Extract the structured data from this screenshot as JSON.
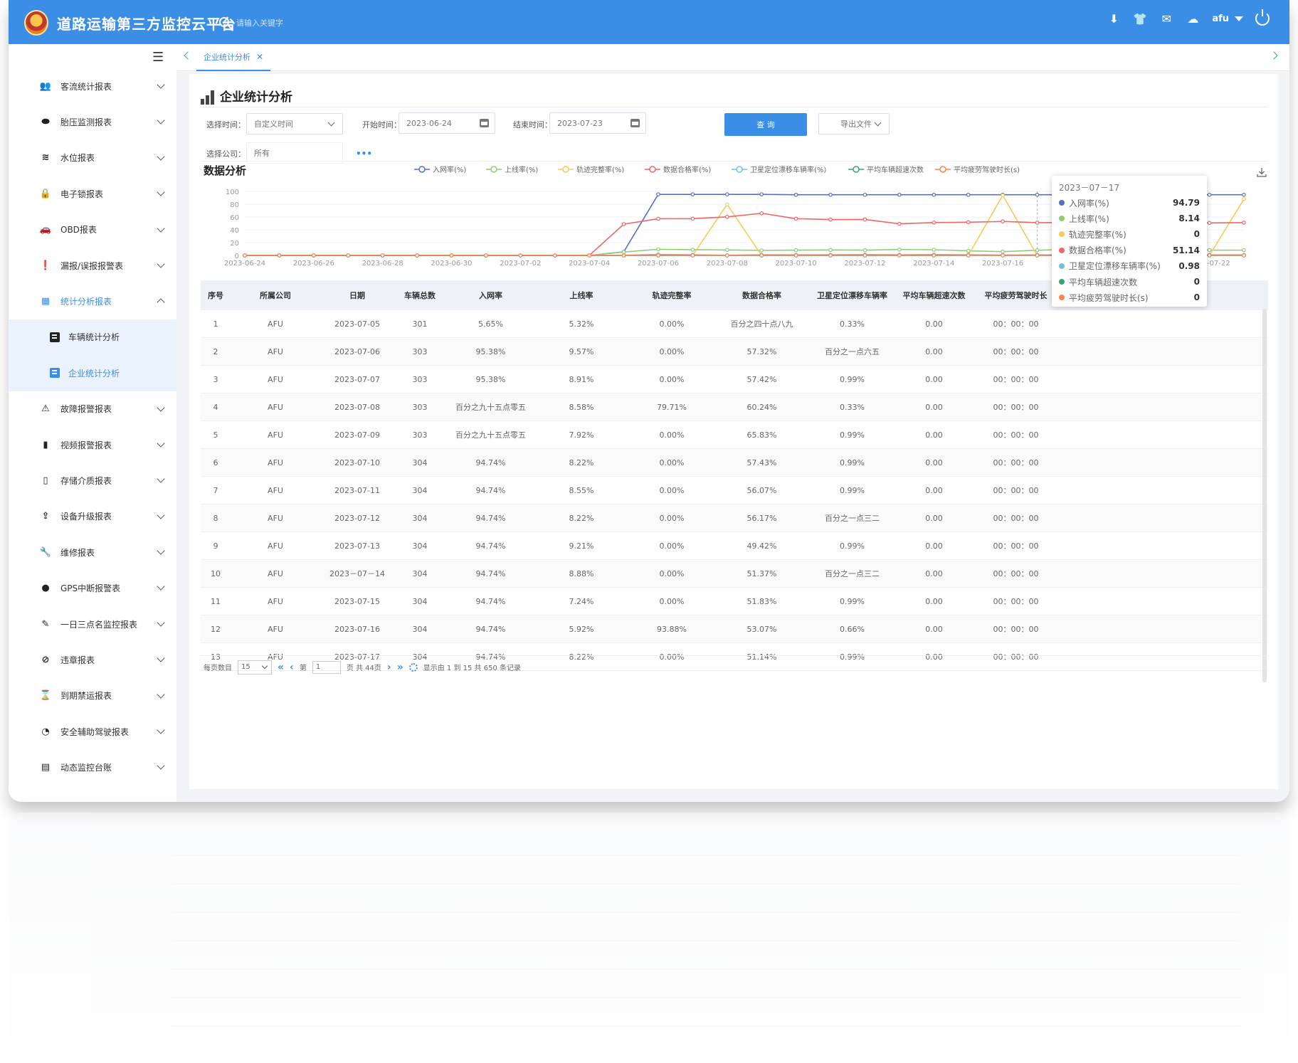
{
  "app": {
    "title": "道路运输第三方监控云平台",
    "search_placeholder": "请输入关键字",
    "user": "afu"
  },
  "sidebar": {
    "items": [
      {
        "label": "客流统计报表",
        "icon": "users-icon"
      },
      {
        "label": "胎压监测报表",
        "icon": "tire-icon"
      },
      {
        "label": "水位报表",
        "icon": "water-icon"
      },
      {
        "label": "电子锁报表",
        "icon": "lock-icon"
      },
      {
        "label": "OBD报表",
        "icon": "car-icon"
      },
      {
        "label": "漏报/误报报警表",
        "icon": "alert-icon"
      },
      {
        "label": "统计分析报表",
        "icon": "table-icon",
        "expanded": true
      },
      {
        "label": "故障报警报表",
        "icon": "fault-icon"
      },
      {
        "label": "视频报警报表",
        "icon": "video-icon"
      },
      {
        "label": "存储介质报表",
        "icon": "storage-icon"
      },
      {
        "label": "设备升级报表",
        "icon": "upload-icon"
      },
      {
        "label": "维修报表",
        "icon": "wrench-icon"
      },
      {
        "label": "GPS中断报警表",
        "icon": "location-icon"
      },
      {
        "label": "一日三点名监控报表",
        "icon": "edit-icon"
      },
      {
        "label": "违章报表",
        "icon": "ban-icon"
      },
      {
        "label": "到期禁运报表",
        "icon": "hourglass-icon"
      },
      {
        "label": "安全辅助驾驶报表",
        "icon": "gauge-icon"
      },
      {
        "label": "动态监控台账",
        "icon": "ledger-icon"
      }
    ],
    "sub_items": [
      {
        "label": "车辆统计分析"
      },
      {
        "label": "企业统计分析",
        "active": true
      }
    ]
  },
  "tabs": [
    {
      "label": "企业统计分析"
    }
  ],
  "page": {
    "title": "企业统计分析"
  },
  "filters": {
    "time_label": "选择时间：",
    "time_value": "自定义时间",
    "start_label": "开始时间：",
    "start_value": "2023-06-24",
    "end_label": "结束时间：",
    "end_value": "2023-07-23",
    "query_label": "查 询",
    "export_label": "导出文件",
    "company_label": "选择公司：",
    "company_value": "所有",
    "more": "•••"
  },
  "chart_data": {
    "type": "line",
    "title": "数据分析",
    "x": [
      "2023-06-24",
      "2023-06-25",
      "2023-06-26",
      "2023-06-27",
      "2023-06-28",
      "2023-06-29",
      "2023-06-30",
      "2023-07-01",
      "2023-07-02",
      "2023-07-03",
      "2023-07-04",
      "2023-07-05",
      "2023-07-06",
      "2023-07-07",
      "2023-07-08",
      "2023-07-09",
      "2023-07-10",
      "2023-07-11",
      "2023-07-12",
      "2023-07-13",
      "2023-07-14",
      "2023-07-15",
      "2023-07-16",
      "2023-07-17",
      "2023-07-18",
      "2023-07-19",
      "2023-07-20",
      "2023-07-21",
      "2023-07-22",
      "2023-07-23"
    ],
    "x_tick_labels": [
      "2023-06-24",
      "2023-06-26",
      "2023-06-28",
      "2023-06-30",
      "2023-07-02",
      "2023-07-04",
      "2023-07-06",
      "2023-07-08",
      "2023-07-10",
      "2023-07-12",
      "2023-07-14",
      "2023-07-16",
      "2023-07-18",
      "2023-07-20",
      "2023-07-22"
    ],
    "ylim": [
      0,
      100
    ],
    "y_ticks": [
      0,
      20,
      40,
      60,
      80,
      100
    ],
    "legend_position": "top",
    "series": [
      {
        "name": "入网率(%)",
        "color": "#5470c6",
        "values": [
          0,
          0,
          0,
          0,
          0,
          0,
          0,
          0,
          0,
          0,
          0,
          5.65,
          95.38,
          95.38,
          95.38,
          95.38,
          94.74,
          94.74,
          94.74,
          94.74,
          94.74,
          94.74,
          94.74,
          94.79,
          94.79,
          94.79,
          94.79,
          94.79,
          94.79,
          94.79
        ]
      },
      {
        "name": "上线率(%)",
        "color": "#91cc75",
        "values": [
          0,
          0,
          0,
          0,
          0,
          0,
          0,
          0,
          0,
          0,
          0,
          5.32,
          9.57,
          8.91,
          8.58,
          7.92,
          8.22,
          8.55,
          8.22,
          9.21,
          8.88,
          7.24,
          5.92,
          8.14,
          9.5,
          8.2,
          8.6,
          8.1,
          8.3,
          8.2
        ]
      },
      {
        "name": "轨迹完整率(%)",
        "color": "#fac858",
        "values": [
          0,
          0,
          0,
          0,
          0,
          0,
          0,
          0,
          0,
          0,
          0,
          0,
          0,
          0,
          79.71,
          0,
          0,
          0,
          0,
          0,
          0,
          0,
          93.88,
          0,
          0,
          0,
          0,
          0,
          0,
          88
        ]
      },
      {
        "name": "数据合格率(%)",
        "color": "#ee6666",
        "values": [
          0,
          0,
          0,
          0,
          0,
          0,
          0,
          0,
          0,
          0,
          0,
          48.89,
          57.32,
          57.42,
          60.24,
          65.83,
          57.43,
          56.07,
          56.17,
          49.42,
          51.37,
          51.83,
          53.07,
          51.14,
          51.5,
          54.5,
          49.5,
          51.5,
          50.8,
          51.2
        ]
      },
      {
        "name": "卫星定位漂移车辆率(%)",
        "color": "#73c0de",
        "values": [
          0,
          0,
          0,
          0,
          0,
          0,
          0,
          0,
          0,
          0,
          0,
          0.33,
          1.65,
          0.99,
          0.33,
          0.99,
          0.99,
          0.99,
          1.32,
          0.99,
          1.32,
          0.99,
          0.66,
          0.98,
          0.9,
          0.9,
          0.9,
          0.9,
          0.9,
          0.9
        ]
      },
      {
        "name": "平均车辆超速次数",
        "color": "#3ba272",
        "values": [
          0,
          0,
          0,
          0,
          0,
          0,
          0,
          0,
          0,
          0,
          0,
          0,
          0,
          0,
          0,
          0,
          0,
          0,
          0,
          0,
          0,
          0,
          0,
          0,
          0,
          0,
          0,
          0,
          0,
          0
        ]
      },
      {
        "name": "平均疲劳驾驶时长(s)",
        "color": "#fc8452",
        "values": [
          0,
          0,
          0,
          0,
          0,
          0,
          0,
          0,
          0,
          0,
          0,
          0,
          0,
          0,
          0,
          0,
          0,
          0,
          0,
          0,
          0,
          0,
          0,
          0,
          0,
          0,
          25,
          0,
          0,
          0
        ]
      }
    ],
    "tooltip": {
      "date": "2023－07－17",
      "rows": [
        {
          "name": "入网率(%)",
          "value": "94.79",
          "color": "#5470c6"
        },
        {
          "name": "上线率(%)",
          "value": "8.14",
          "color": "#91cc75"
        },
        {
          "name": "轨迹完整率(%)",
          "value": "0",
          "color": "#fac858"
        },
        {
          "name": "数据合格率(%)",
          "value": "51.14",
          "color": "#ee6666"
        },
        {
          "name": "卫星定位漂移车辆率(%)",
          "value": "0.98",
          "color": "#73c0de"
        },
        {
          "name": "平均车辆超速次数",
          "value": "0",
          "color": "#3ba272"
        },
        {
          "name": "平均疲劳驾驶时长(s)",
          "value": "0",
          "color": "#fc8452"
        }
      ]
    }
  },
  "table": {
    "columns": [
      "序号",
      "所属公司",
      "日期",
      "车辆总数",
      "入网率",
      "上线率",
      "轨迹完整率",
      "数据合格率",
      "卫星定位漂移车辆率",
      "平均车辆超速次数",
      "平均疲劳驾驶时长"
    ],
    "rows": [
      [
        "1",
        "AFU",
        "2023-07-05",
        "301",
        "5.65%",
        "5.32%",
        "0.00%",
        "百分之四十点八九",
        "0.33%",
        "0.00",
        "00：00：00"
      ],
      [
        "2",
        "AFU",
        "2023-07-06",
        "303",
        "95.38%",
        "9.57%",
        "0.00%",
        "57.32%",
        "百分之一点六五",
        "0.00",
        "00：00：00"
      ],
      [
        "3",
        "AFU",
        "2023-07-07",
        "303",
        "95.38%",
        "8.91%",
        "0.00%",
        "57.42%",
        "0.99%",
        "0.00",
        "00：00：00"
      ],
      [
        "4",
        "AFU",
        "2023-07-08",
        "303",
        "百分之九十五点零五",
        "8.58%",
        "79.71%",
        "60.24%",
        "0.33%",
        "0.00",
        "00：00：00"
      ],
      [
        "5",
        "AFU",
        "2023-07-09",
        "303",
        "百分之九十五点零五",
        "7.92%",
        "0.00%",
        "65.83%",
        "0.99%",
        "0.00",
        "00：00：00"
      ],
      [
        "6",
        "AFU",
        "2023-07-10",
        "304",
        "94.74%",
        "8.22%",
        "0.00%",
        "57.43%",
        "0.99%",
        "0.00",
        "00：00：00"
      ],
      [
        "7",
        "AFU",
        "2023-07-11",
        "304",
        "94.74%",
        "8.55%",
        "0.00%",
        "56.07%",
        "0.99%",
        "0.00",
        "00：00：00"
      ],
      [
        "8",
        "AFU",
        "2023-07-12",
        "304",
        "94.74%",
        "8.22%",
        "0.00%",
        "56.17%",
        "百分之一点三二",
        "0.00",
        "00：00：00"
      ],
      [
        "9",
        "AFU",
        "2023-07-13",
        "304",
        "94.74%",
        "9.21%",
        "0.00%",
        "49.42%",
        "0.99%",
        "0.00",
        "00：00：00"
      ],
      [
        "10",
        "AFU",
        "2023－07－14",
        "304",
        "94.74%",
        "8.88%",
        "0.00%",
        "51.37%",
        "百分之一点三二",
        "0.00",
        "00：00：00"
      ],
      [
        "11",
        "AFU",
        "2023-07-15",
        "304",
        "94.74%",
        "7.24%",
        "0.00%",
        "51.83%",
        "0.99%",
        "0.00",
        "00：00：00"
      ],
      [
        "12",
        "AFU",
        "2023-07-16",
        "304",
        "94.74%",
        "5.92%",
        "93.88%",
        "53.07%",
        "0.66%",
        "0.00",
        "00：00：00"
      ],
      [
        "13",
        "AFU",
        "2023-07-17",
        "304",
        "94.74%",
        "8.22%",
        "0.00%",
        "51.14%",
        "0.99%",
        "0.00",
        "00：00：00"
      ]
    ]
  },
  "pager": {
    "per_page_label": "每页数目",
    "per_page": "15",
    "page_prefix": "第",
    "page": "1",
    "page_suffix": "页 共 44页",
    "summary": "显示由 1 到 15 共 650 条记录"
  }
}
